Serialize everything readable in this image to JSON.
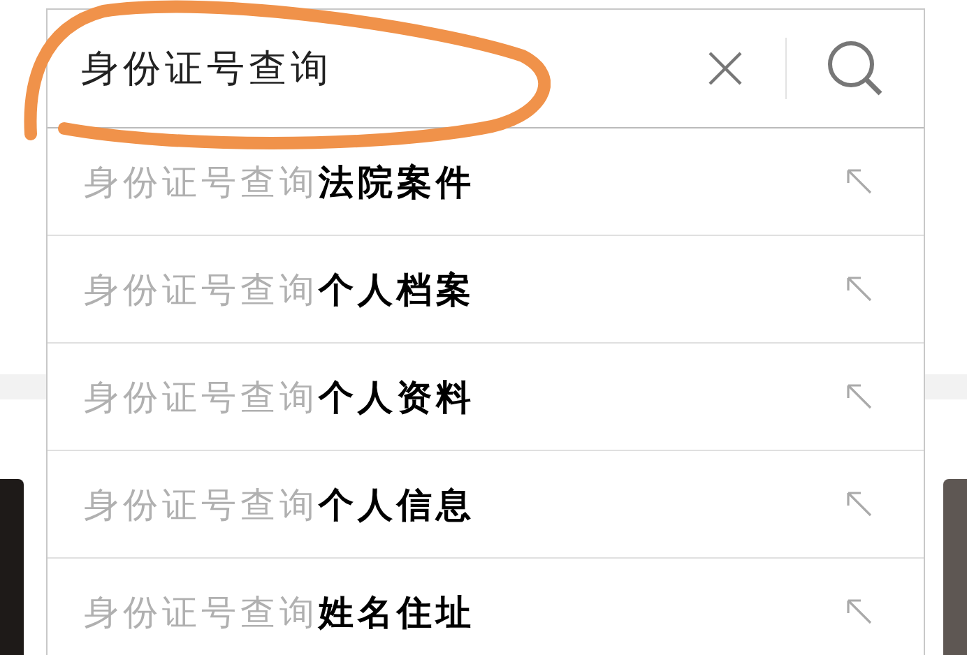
{
  "search": {
    "value": "身份证号查询"
  },
  "suggestions": [
    {
      "typed": "身份证号查询",
      "completion": "法院案件"
    },
    {
      "typed": "身份证号查询",
      "completion": "个人档案"
    },
    {
      "typed": "身份证号查询",
      "completion": "个人资料"
    },
    {
      "typed": "身份证号查询",
      "completion": "个人信息"
    },
    {
      "typed": "身份证号查询",
      "completion": "姓名住址"
    }
  ]
}
